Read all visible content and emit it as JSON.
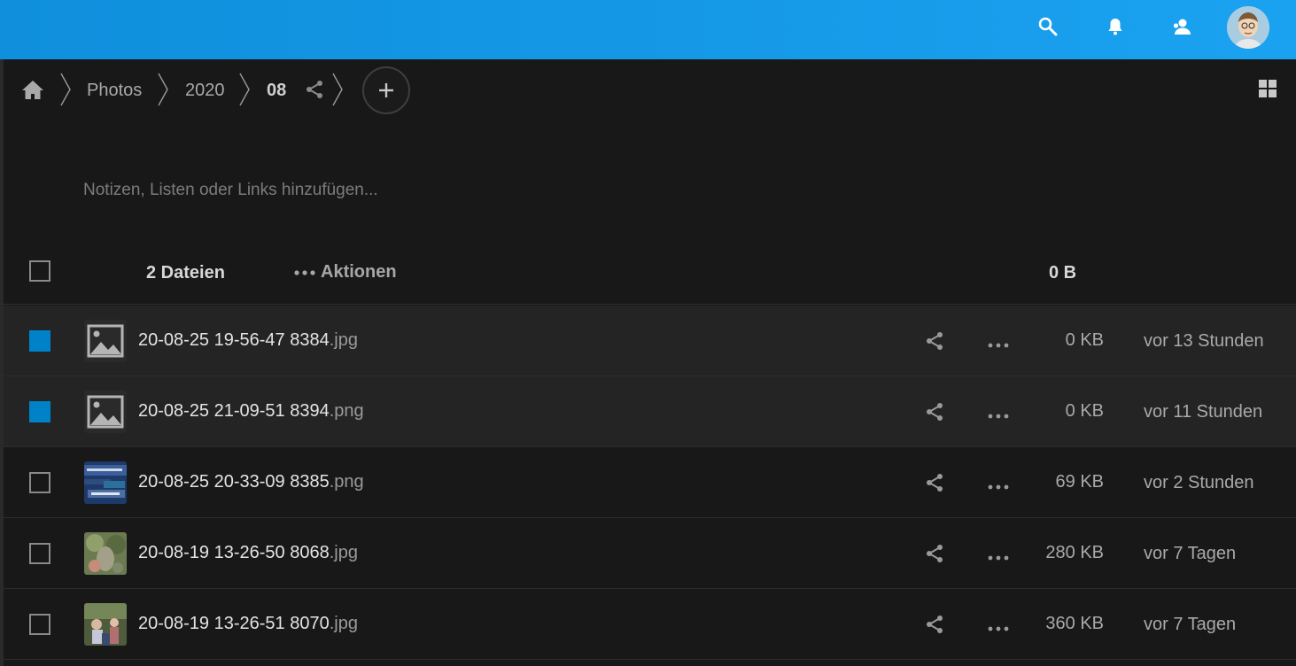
{
  "header": {
    "icons": [
      "search-icon",
      "bell-icon",
      "contacts-icon"
    ],
    "accent_color": "#1aa2f0",
    "avatar": "user-avatar"
  },
  "breadcrumb": {
    "items": [
      "Photos",
      "2020",
      "08"
    ]
  },
  "notes": {
    "placeholder": "Notizen, Listen oder Links hinzufügen..."
  },
  "table": {
    "files_count": "2 Dateien",
    "actions_label": "Aktionen",
    "total_size": "0 B",
    "selection_color": "#0082c9"
  },
  "files": [
    {
      "name": "20-08-25 19-56-47 8384",
      "ext": ".jpg",
      "size": "0 KB",
      "modified": "vor 13 Stunden",
      "selected": true,
      "thumb": "image-placeholder"
    },
    {
      "name": "20-08-25 21-09-51 8394",
      "ext": ".png",
      "size": "0 KB",
      "modified": "vor 11 Stunden",
      "selected": true,
      "thumb": "image-placeholder"
    },
    {
      "name": "20-08-25 20-33-09 8385",
      "ext": ".png",
      "size": "69 KB",
      "modified": "vor 2 Stunden",
      "selected": false,
      "thumb": "screenshot-thumbnail"
    },
    {
      "name": "20-08-19 13-26-50 8068",
      "ext": ".jpg",
      "size": "280 KB",
      "modified": "vor 7 Tagen",
      "selected": false,
      "thumb": "photo-thumbnail"
    },
    {
      "name": "20-08-19 13-26-51 8070",
      "ext": ".jpg",
      "size": "360 KB",
      "modified": "vor 7 Tagen",
      "selected": false,
      "thumb": "photo-thumbnail"
    }
  ]
}
